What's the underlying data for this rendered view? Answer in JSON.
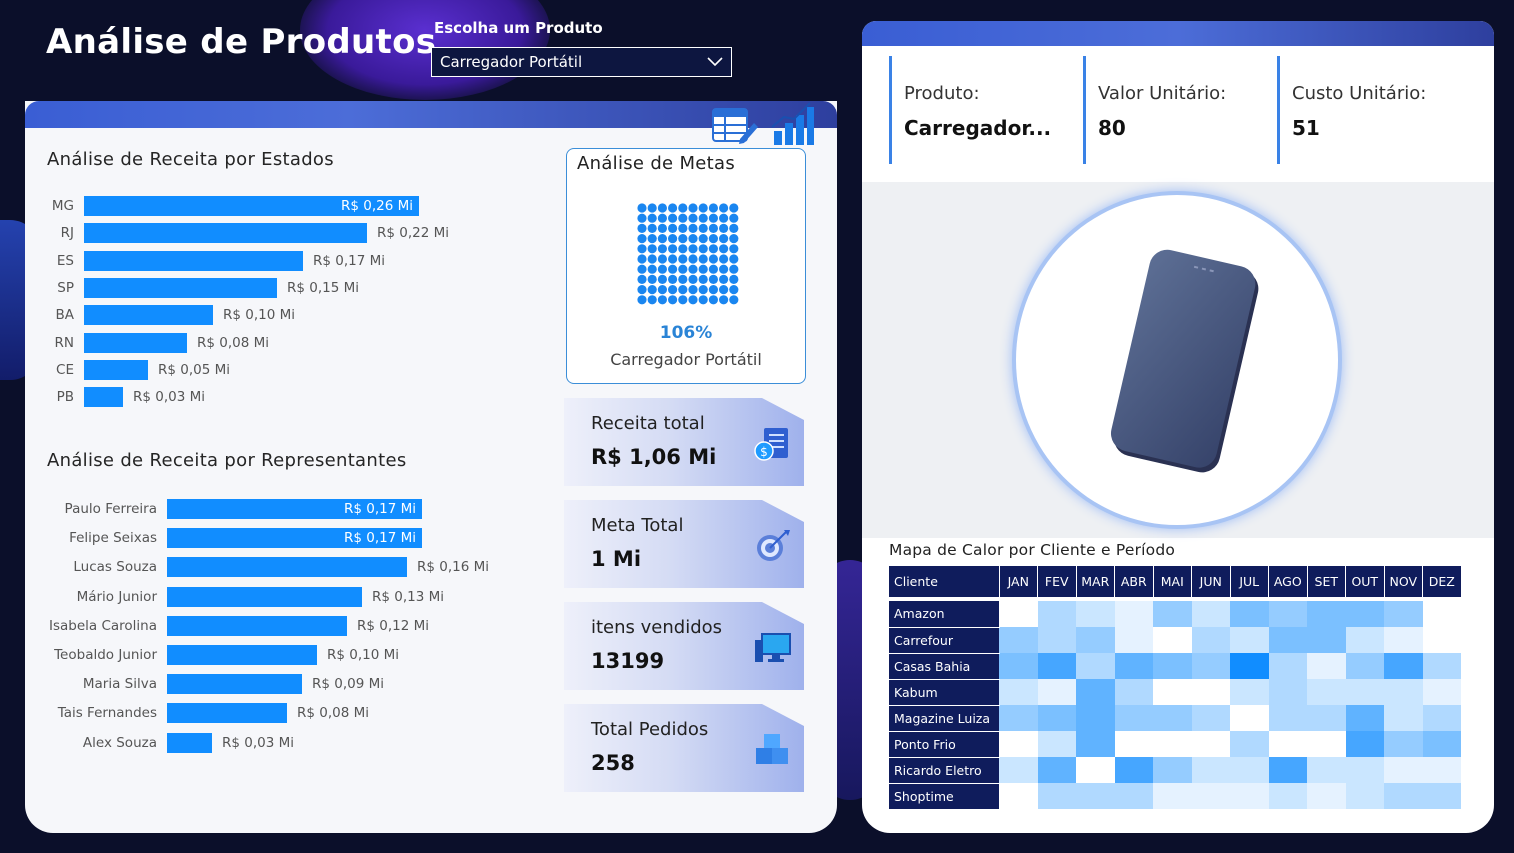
{
  "header": {
    "title": "Análise de Produtos"
  },
  "selector": {
    "label": "Escolha um Produto",
    "value": "Carregador Portátil"
  },
  "states": {
    "title": "Análise de Receita por Estados",
    "items": [
      {
        "label": "MG",
        "value": 0.26,
        "text": "R$ 0,26 Mi"
      },
      {
        "label": "RJ",
        "value": 0.22,
        "text": "R$ 0,22 Mi"
      },
      {
        "label": "ES",
        "value": 0.17,
        "text": "R$ 0,17 Mi"
      },
      {
        "label": "SP",
        "value": 0.15,
        "text": "R$ 0,15 Mi"
      },
      {
        "label": "BA",
        "value": 0.1,
        "text": "R$ 0,10 Mi"
      },
      {
        "label": "RN",
        "value": 0.08,
        "text": "R$ 0,08 Mi"
      },
      {
        "label": "CE",
        "value": 0.05,
        "text": "R$ 0,05 Mi"
      },
      {
        "label": "PB",
        "value": 0.03,
        "text": "R$ 0,03 Mi"
      }
    ]
  },
  "reps": {
    "title": "Análise de Receita por Representantes",
    "items": [
      {
        "label": "Paulo Ferreira",
        "value": 0.17,
        "text": "R$ 0,17 Mi"
      },
      {
        "label": "Felipe Seixas",
        "value": 0.17,
        "text": "R$ 0,17 Mi"
      },
      {
        "label": "Lucas Souza",
        "value": 0.16,
        "text": "R$ 0,16 Mi"
      },
      {
        "label": "Mário Junior",
        "value": 0.13,
        "text": "R$ 0,13 Mi"
      },
      {
        "label": "Isabela Carolina",
        "value": 0.12,
        "text": "R$ 0,12 Mi"
      },
      {
        "label": "Teobaldo Junior",
        "value": 0.1,
        "text": "R$ 0,10 Mi"
      },
      {
        "label": "Maria Silva",
        "value": 0.09,
        "text": "R$ 0,09 Mi"
      },
      {
        "label": "Tais Fernandes",
        "value": 0.08,
        "text": "R$ 0,08 Mi"
      },
      {
        "label": "Alex Souza",
        "value": 0.03,
        "text": "R$ 0,03 Mi"
      }
    ]
  },
  "metas": {
    "title": "Análise de Metas",
    "pct": "106%",
    "produto": "Carregador Portátil"
  },
  "kpis": {
    "receita": {
      "label": "Receita total",
      "value": "R$ 1,06 Mi",
      "icon": "money-document-icon"
    },
    "meta": {
      "label": "Meta Total",
      "value": "1 Mi",
      "icon": "target-icon"
    },
    "itens": {
      "label": "itens vendidos",
      "value": "13199",
      "icon": "computer-icon"
    },
    "pedidos": {
      "label": "Total Pedidos",
      "value": "258",
      "icon": "boxes-icon"
    }
  },
  "info": {
    "produto": {
      "label": "Produto:",
      "value": "Carregador..."
    },
    "valor": {
      "label": "Valor Unitário:",
      "value": "80"
    },
    "custo": {
      "label": "Custo Unitário:",
      "value": "51"
    }
  },
  "heatmap": {
    "title": "Mapa de Calor por Cliente e Período",
    "header": "Cliente",
    "months": [
      "JAN",
      "FEV",
      "MAR",
      "ABR",
      "MAI",
      "JUN",
      "JUL",
      "AGO",
      "SET",
      "OUT",
      "NOV",
      "DEZ"
    ],
    "rows": [
      {
        "client": "Amazon",
        "values": [
          0,
          3,
          2,
          1,
          4,
          2,
          5,
          4,
          5,
          5,
          4,
          0
        ]
      },
      {
        "client": "Carrefour",
        "values": [
          4,
          3,
          4,
          1,
          0,
          3,
          2,
          5,
          5,
          2,
          1,
          0
        ]
      },
      {
        "client": "Casas Bahia",
        "values": [
          5,
          7,
          3,
          6,
          5,
          4,
          9,
          3,
          1,
          4,
          7,
          3
        ]
      },
      {
        "client": "Kabum",
        "values": [
          2,
          1,
          6,
          3,
          0,
          0,
          2,
          3,
          2,
          2,
          2,
          1
        ]
      },
      {
        "client": "Magazine Luiza",
        "values": [
          4,
          5,
          6,
          4,
          4,
          3,
          0,
          3,
          3,
          6,
          2,
          3
        ]
      },
      {
        "client": "Ponto Frio",
        "values": [
          0,
          2,
          6,
          0,
          0,
          0,
          3,
          0,
          0,
          7,
          4,
          5
        ]
      },
      {
        "client": "Ricardo Eletro",
        "values": [
          2,
          6,
          0,
          7,
          4,
          2,
          2,
          7,
          2,
          2,
          1,
          1
        ]
      },
      {
        "client": "Shoptime",
        "values": [
          0,
          3,
          3,
          3,
          1,
          1,
          1,
          2,
          1,
          2,
          3,
          3
        ]
      }
    ]
  }
}
